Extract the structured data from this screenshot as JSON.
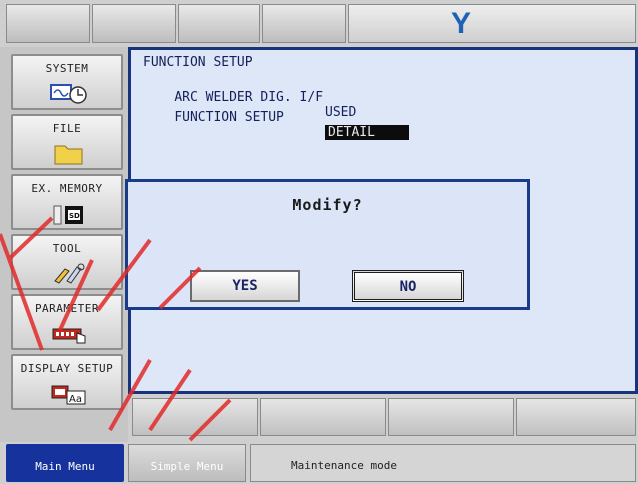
{
  "logo_text": "Y",
  "left_menu": {
    "items": [
      {
        "label": "SYSTEM",
        "icon": "system-clock-icon"
      },
      {
        "label": "FILE",
        "icon": "folder-icon"
      },
      {
        "label": "EX. MEMORY",
        "icon": "sd-card-icon"
      },
      {
        "label": "TOOL",
        "icon": "tool-icon"
      },
      {
        "label": "PARAMETER",
        "icon": "parameter-icon"
      },
      {
        "label": "DISPLAY SETUP",
        "icon": "display-setup-icon"
      }
    ]
  },
  "main": {
    "title": "FUNCTION SETUP",
    "rows": [
      {
        "label": "ARC WELDER DIG. I/F",
        "value": "USED"
      },
      {
        "label": "FUNCTION SETUP",
        "value": "DETAIL"
      }
    ]
  },
  "dialog": {
    "message": "Modify?",
    "yes_label": "YES",
    "no_label": "NO"
  },
  "bottom": {
    "main_menu_label": "Main Menu",
    "simple_menu_label": "Simple Menu",
    "status_text": "Maintenance mode"
  },
  "colors": {
    "accent": "#16339d",
    "logo": "#1d62b5",
    "panel_border": "#16337c"
  }
}
